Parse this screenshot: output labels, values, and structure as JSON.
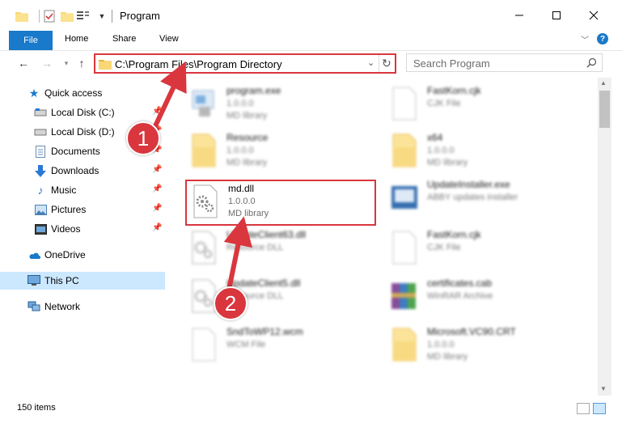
{
  "window": {
    "title": "Program",
    "controls": {
      "minimize": "minimize-icon",
      "maximize": "maximize-icon",
      "close": "close-icon"
    }
  },
  "ribbon": {
    "tabs": [
      "File",
      "Home",
      "Share",
      "View"
    ],
    "help_icon": "?"
  },
  "navigation": {
    "address_path": "C:\\Program Files\\Program Directory",
    "search_placeholder": "Search Program"
  },
  "sidebar": {
    "items": [
      {
        "label": "Quick access",
        "icon": "star-icon",
        "pinned": false
      },
      {
        "label": "Local Disk (C:)",
        "icon": "drive-icon",
        "pinned": true
      },
      {
        "label": "Local Disk (D:)",
        "icon": "drive-icon",
        "pinned": true
      },
      {
        "label": "Documents",
        "icon": "documents-icon",
        "pinned": true
      },
      {
        "label": "Downloads",
        "icon": "download-icon",
        "pinned": true
      },
      {
        "label": "Music",
        "icon": "music-icon",
        "pinned": true
      },
      {
        "label": "Pictures",
        "icon": "pictures-icon",
        "pinned": true
      },
      {
        "label": "Videos",
        "icon": "videos-icon",
        "pinned": true
      },
      {
        "label": "OneDrive",
        "icon": "cloud-icon",
        "pinned": false
      },
      {
        "label": "This PC",
        "icon": "computer-icon",
        "pinned": false,
        "selected": true
      },
      {
        "label": "Network",
        "icon": "network-icon",
        "pinned": false
      }
    ]
  },
  "files": [
    {
      "name": "program.exe",
      "version": "1.0.0.0",
      "type": "MD library",
      "icon": "exe-icon"
    },
    {
      "name": "FastKorn.cjk",
      "version": "",
      "type": "CJK File",
      "icon": "blank-file-icon"
    },
    {
      "name": "Resource",
      "version": "1.0.0.0",
      "type": "MD library",
      "icon": "folder-file-icon"
    },
    {
      "name": "x64",
      "version": "1.0.0.0",
      "type": "MD library",
      "icon": "folder-file-icon"
    },
    {
      "name": "md.dll",
      "version": "1.0.0.0",
      "type": "MD library",
      "icon": "dll-gear-icon",
      "highlighted": true
    },
    {
      "name": "UpdateInstaller.exe",
      "version": "",
      "type": "ABBY updates installer",
      "icon": "installer-icon"
    },
    {
      "name": "UpdateClient63.dll",
      "version": "",
      "type": "Resource DLL",
      "icon": "dll-gear-icon"
    },
    {
      "name": "FastKorn.cjk",
      "version": "",
      "type": "CJK File",
      "icon": "blank-file-icon"
    },
    {
      "name": "UpdateClient5.dll",
      "version": "",
      "type": "Resource DLL",
      "icon": "dll-gear-icon"
    },
    {
      "name": "certificates.cab",
      "version": "",
      "type": "WinRAR Archive",
      "icon": "archive-icon"
    },
    {
      "name": "SndToWP12.wcm",
      "version": "",
      "type": "WCM File",
      "icon": "blank-file-icon"
    },
    {
      "name": "Microsoft.VC90.CRT",
      "version": "1.0.0.0",
      "type": "MD library",
      "icon": "folder-file-icon"
    }
  ],
  "status": {
    "item_count": "150 items"
  },
  "annotations": {
    "step1": "1",
    "step2": "2"
  },
  "colors": {
    "accent": "#1979ca",
    "highlight_red": "#d9363e",
    "selected_bg": "#cce8ff"
  }
}
